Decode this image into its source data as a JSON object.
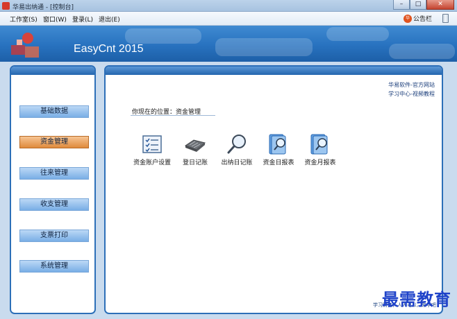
{
  "window": {
    "title": "华易出纳通 - [控制台]",
    "buttons": [
      "–",
      "□",
      "✕"
    ]
  },
  "menu": {
    "items": [
      "工作室(S)",
      "窗口(W)",
      "登录(L)",
      "退出(E)"
    ],
    "notice_label": "公告栏",
    "notice_badge": "华"
  },
  "banner": {
    "app_name": "EasyCnt 2015"
  },
  "sidebar": {
    "items": [
      {
        "label": "基础数据",
        "active": false
      },
      {
        "label": "资金管理",
        "active": true
      },
      {
        "label": "往来管理",
        "active": false
      },
      {
        "label": "收支管理",
        "active": false
      },
      {
        "label": "支票打印",
        "active": false
      },
      {
        "label": "系统管理",
        "active": false
      }
    ]
  },
  "main": {
    "links": [
      "华易软件-官方网站",
      "学习中心-视频教程"
    ],
    "location": "你现在的位置：资金管理",
    "functions": [
      {
        "label": "资金账户设置",
        "icon": "account-settings-icon"
      },
      {
        "label": "登日记账",
        "icon": "journal-keyboard-icon"
      },
      {
        "label": "出纳日记账",
        "icon": "magnifier-icon"
      },
      {
        "label": "资金日报表",
        "icon": "daily-report-icon"
      },
      {
        "label": "资金月报表",
        "icon": "monthly-report-icon"
      }
    ],
    "footer": "学习财务，人人可以，来学吧"
  },
  "watermark": "最需教育",
  "colors": {
    "accent": "#2c6fb8",
    "active": "#df8a3c"
  }
}
